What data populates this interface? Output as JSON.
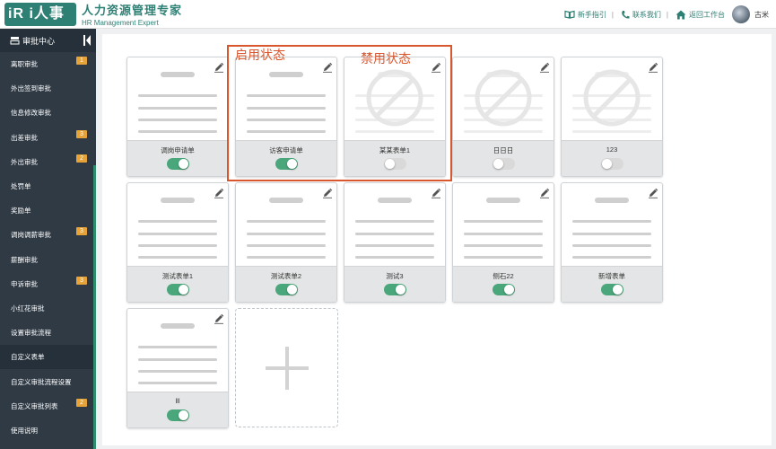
{
  "brand": {
    "logo_text": "iR i人事",
    "name_cn": "人力资源管理专家",
    "name_en": "HR Management Expert",
    "accent": "#2e7f74"
  },
  "topnav": {
    "guide": "新手指引",
    "contact": "联系我们",
    "workbench": "返回工作台",
    "user": "古米"
  },
  "sidebar": {
    "title": "审批中心",
    "items": [
      {
        "label": "离职审批",
        "badge": "1"
      },
      {
        "label": "外出签到审批",
        "badge": ""
      },
      {
        "label": "信息修改审批",
        "badge": ""
      },
      {
        "label": "出差审批",
        "badge": "3"
      },
      {
        "label": "外出审批",
        "badge": "2"
      },
      {
        "label": "处罚单",
        "badge": ""
      },
      {
        "label": "奖励单",
        "badge": ""
      },
      {
        "label": "调岗调薪审批",
        "badge": "3"
      },
      {
        "label": "薪酬审批",
        "badge": ""
      },
      {
        "label": "申诉审批",
        "badge": "3"
      },
      {
        "label": "小红花审批",
        "badge": ""
      },
      {
        "label": "设置审批流程",
        "badge": ""
      },
      {
        "label": "自定义表单",
        "badge": ""
      },
      {
        "label": "自定义审批流程设置",
        "badge": ""
      },
      {
        "label": "自定义审批列表",
        "badge": "2"
      },
      {
        "label": "使用说明",
        "badge": ""
      }
    ],
    "active_index": 12
  },
  "forms": [
    {
      "name": "调岗申请单",
      "enabled": true
    },
    {
      "name": "访客申请单",
      "enabled": true
    },
    {
      "name": "某某表单1",
      "enabled": false
    },
    {
      "name": "日日日",
      "enabled": false
    },
    {
      "name": "123",
      "enabled": false
    },
    {
      "name": "测试表单1",
      "enabled": true
    },
    {
      "name": "测试表单2",
      "enabled": true
    },
    {
      "name": "测试3",
      "enabled": true
    },
    {
      "name": "侧石22",
      "enabled": true
    },
    {
      "name": "新增表单",
      "enabled": true
    },
    {
      "name": "lll",
      "enabled": true
    }
  ],
  "annotations": {
    "enabled_label": "启用状态",
    "disabled_label": "禁用状态",
    "color": "#d9572f"
  }
}
